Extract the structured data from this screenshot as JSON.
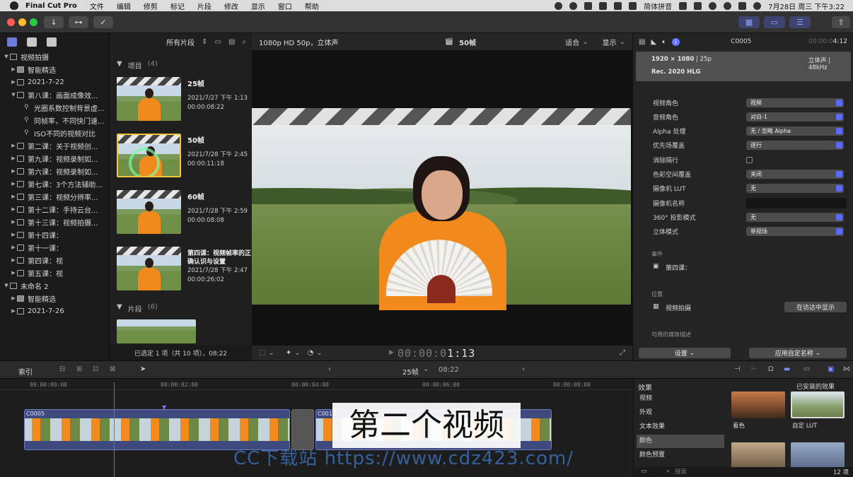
{
  "menubar": {
    "app_name": "Final Cut Pro",
    "items": [
      "文件",
      "编辑",
      "修剪",
      "标记",
      "片段",
      "修改",
      "显示",
      "窗口",
      "帮助"
    ],
    "input_method": "简体拼音",
    "datetime": "7月28日 周三 下午3:22"
  },
  "library": {
    "rows": [
      {
        "label": "视频拍摄",
        "level": 0,
        "type": "library",
        "open": true
      },
      {
        "label": "智能精选",
        "level": 1,
        "type": "folder",
        "open": false
      },
      {
        "label": "2021-7-22",
        "level": 1,
        "type": "event",
        "open": false
      },
      {
        "label": "第八课：画面成像效...",
        "level": 1,
        "type": "event",
        "open": true
      },
      {
        "label": "光圈系数控制背景虚...",
        "level": 2,
        "type": "keyword"
      },
      {
        "label": "同帧率，不同快门速...",
        "level": 2,
        "type": "keyword"
      },
      {
        "label": "ISO不同的视频对比",
        "level": 2,
        "type": "keyword"
      },
      {
        "label": "第二课：关于视频创...",
        "level": 1,
        "type": "event",
        "open": false
      },
      {
        "label": "第九课：视频录制如...",
        "level": 1,
        "type": "event",
        "open": false
      },
      {
        "label": "第六课：视频录制如...",
        "level": 1,
        "type": "event",
        "open": false
      },
      {
        "label": "第七课：3个方法辅助...",
        "level": 1,
        "type": "event",
        "open": false
      },
      {
        "label": "第三课：视频分辨率...",
        "level": 1,
        "type": "event",
        "open": false
      },
      {
        "label": "第十二课：手持云台...",
        "level": 1,
        "type": "event",
        "open": false
      },
      {
        "label": "第十三课：视频拍摄...",
        "level": 1,
        "type": "event",
        "open": false
      },
      {
        "label": "第十四课：",
        "level": 1,
        "type": "event",
        "open": false
      },
      {
        "label": "第十一课：",
        "level": 1,
        "type": "event",
        "open": false
      },
      {
        "label": "第四课：视",
        "level": 1,
        "type": "event",
        "open": false
      },
      {
        "label": "第五课：视",
        "level": 1,
        "type": "event",
        "open": false
      },
      {
        "label": "未命名 2",
        "level": 0,
        "type": "library",
        "open": true
      },
      {
        "label": "智能精选",
        "level": 1,
        "type": "folder",
        "open": false
      },
      {
        "label": "2021-7-26",
        "level": 1,
        "type": "event",
        "open": false
      }
    ]
  },
  "browser": {
    "filter_label": "所有片段",
    "projects_header": "项目",
    "projects_count": "(4)",
    "clips_header": "片段",
    "clips_count": "(6)",
    "projects": [
      {
        "name": "25帧",
        "date": "2021/7/27 下午 1:13",
        "duration": "00:00:08:22"
      },
      {
        "name": "50帧",
        "date": "2021/7/28 下午 2:45",
        "duration": "00:00:11:18"
      },
      {
        "name": "60帧",
        "date": "2021/7/28 下午 2:59",
        "duration": "00:00:08:08"
      },
      {
        "name": "第四课：视频帧率的正确认识与设置",
        "date": "2021/7/28 下午 2:47",
        "duration": "00:00:26:02"
      }
    ],
    "footer": "已选定 1 项（共 10 项），08:22"
  },
  "viewer": {
    "format": "1080p HD 50p，立体声",
    "project_name": "50帧",
    "fit_label": "适合",
    "display_label": "显示",
    "timecode_dim": "00:00:0",
    "timecode_bright": "1:13"
  },
  "inspector": {
    "clip_name": "C0005",
    "duration": "4:12",
    "duration_dim": "00:00:0",
    "resolution": "1920 × 1080",
    "framerate": "25p",
    "audio": "立体声",
    "samplerate": "48kHz",
    "color_profile": "Rec. 2020 HLG",
    "fields": [
      {
        "label": "视频角色",
        "value": "视频",
        "kind": "pop"
      },
      {
        "label": "音频角色",
        "value": "对白-1",
        "kind": "pop"
      },
      {
        "label": "Alpha 处理",
        "value": "无 / 忽略 Alpha",
        "kind": "pop"
      },
      {
        "label": "优先场覆盖",
        "value": "逐行",
        "kind": "pop"
      },
      {
        "label": "消除隔行",
        "value": "",
        "kind": "check"
      },
      {
        "label": "色彩空间覆盖",
        "value": "关闭",
        "kind": "pop"
      },
      {
        "label": "摄像机 LUT",
        "value": "无",
        "kind": "pop"
      },
      {
        "label": "摄像机名称",
        "value": "",
        "kind": "text"
      },
      {
        "label": "360° 投影模式",
        "value": "无",
        "kind": "pop"
      },
      {
        "label": "立体模式",
        "value": "单视场",
        "kind": "pop"
      }
    ],
    "event_section": "事件",
    "event_name": "第四课：",
    "location_section": "位置",
    "location_name": "视频拍摄",
    "reveal_button": "在访达中显示",
    "media_desc_section": "可用的媒体描述",
    "settings_button": "设置",
    "apply_button": "应用自定名称"
  },
  "timeline_toolbar": {
    "index_label": "索引",
    "project_name": "25帧",
    "duration": "08:22"
  },
  "timeline": {
    "ticks": [
      "00:00:00:00",
      "00:00:02:00",
      "00:00:04:00",
      "00:00:06:00",
      "00:00:08:00"
    ],
    "clips": [
      {
        "name": "C0005"
      },
      {
        "name": "C0010"
      }
    ]
  },
  "effects": {
    "title": "效果",
    "installed_label": "已安装的效果",
    "categories": [
      "视频",
      "外观",
      "文本效果",
      "颜色",
      "颜色预置"
    ],
    "selected_category": "颜色",
    "items": [
      {
        "name": "着色"
      },
      {
        "name": "自定 LUT"
      }
    ],
    "search_placeholder": "搜索",
    "count": "12 项"
  },
  "overlay": {
    "subtitle": "第二个视频",
    "watermark": "CC下载站 https://www.cdz423.com/"
  },
  "colors": {
    "accent": "#5b69ff",
    "playhead": "#e0464c",
    "selection": "#f2c53d",
    "clip": "#3e4a7e"
  }
}
